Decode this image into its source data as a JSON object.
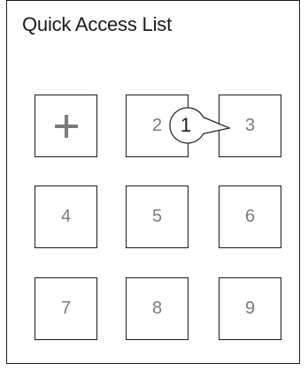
{
  "panel": {
    "title": "Quick Access List"
  },
  "tiles": [
    {
      "label": "",
      "icon": "plus-icon"
    },
    {
      "label": "2"
    },
    {
      "label": "3"
    },
    {
      "label": "4"
    },
    {
      "label": "5"
    },
    {
      "label": "6"
    },
    {
      "label": "7"
    },
    {
      "label": "8"
    },
    {
      "label": "9"
    }
  ],
  "callout": {
    "label": "1"
  },
  "colors": {
    "border": "#1a1a1a",
    "tile_text": "#7a7a7a",
    "background": "#ffffff"
  }
}
